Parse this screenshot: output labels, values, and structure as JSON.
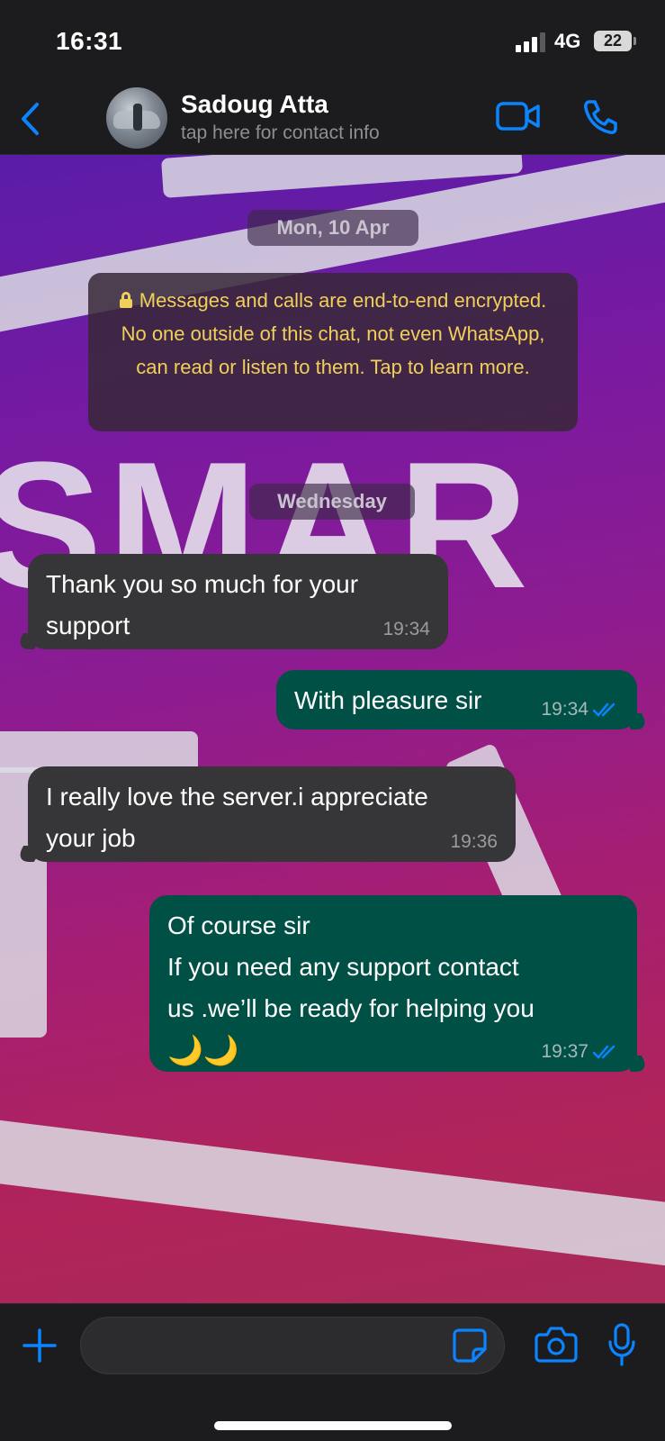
{
  "status_bar": {
    "time": "16:31",
    "network": "4G",
    "battery": "22"
  },
  "header": {
    "contact_name": "Sadoug Atta",
    "subtitle": "tap here for contact info"
  },
  "chat": {
    "wallpaper_text_1": "SMAR",
    "date_1": "Mon, 10 Apr",
    "encryption_notice": "Messages and calls are end-to-end encrypted. No one outside of this chat, not even WhatsApp, can read or listen to them. Tap to learn more.",
    "date_2": "Wednesday",
    "messages": [
      {
        "direction": "in",
        "lines": [
          "Thank you so much for your",
          "support"
        ],
        "time": "19:34"
      },
      {
        "direction": "out",
        "lines": [
          "With pleasure sir"
        ],
        "time": "19:34",
        "status": "read"
      },
      {
        "direction": "in",
        "lines": [
          "I really love the server.i appreciate",
          "your job"
        ],
        "time": "19:36"
      },
      {
        "direction": "out",
        "lines": [
          "Of course sir",
          "If you need any support contact",
          "us .we’ll be ready for helping you"
        ],
        "emoji": "🌙🌙",
        "time": "19:37",
        "status": "read"
      }
    ]
  },
  "input": {
    "placeholder": ""
  },
  "colors": {
    "accent": "#0a84ff",
    "incoming_bubble": "#363638",
    "outgoing_bubble": "#005046",
    "notice_text": "#f0cf5a"
  },
  "icons": [
    "back-chevron-icon",
    "video-call-icon",
    "phone-icon",
    "lock-icon",
    "double-check-icon",
    "plus-icon",
    "sticker-icon",
    "camera-icon",
    "microphone-icon"
  ]
}
